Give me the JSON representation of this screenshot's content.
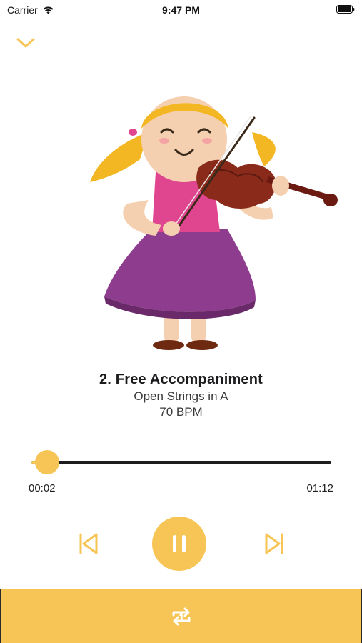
{
  "status_bar": {
    "carrier": "Carrier",
    "time": "9:47 PM"
  },
  "icons": {
    "collapse": "chevron-down-icon",
    "previous": "skip-previous-icon",
    "play_pause": "pause-icon",
    "next": "skip-next-icon",
    "repeat": "repeat-one-icon",
    "wifi": "wifi-icon",
    "battery": "battery-icon"
  },
  "colors": {
    "accent": "#f6c555",
    "track": "#1c1c1e"
  },
  "artwork": {
    "subject": "girl-playing-violin"
  },
  "track": {
    "title": "2. Free Accompaniment",
    "subtitle": "Open Strings in A",
    "tempo": "70 BPM"
  },
  "playback": {
    "elapsed": "00:02",
    "duration": "01:12",
    "progress_fraction": 0.028,
    "state": "playing"
  }
}
